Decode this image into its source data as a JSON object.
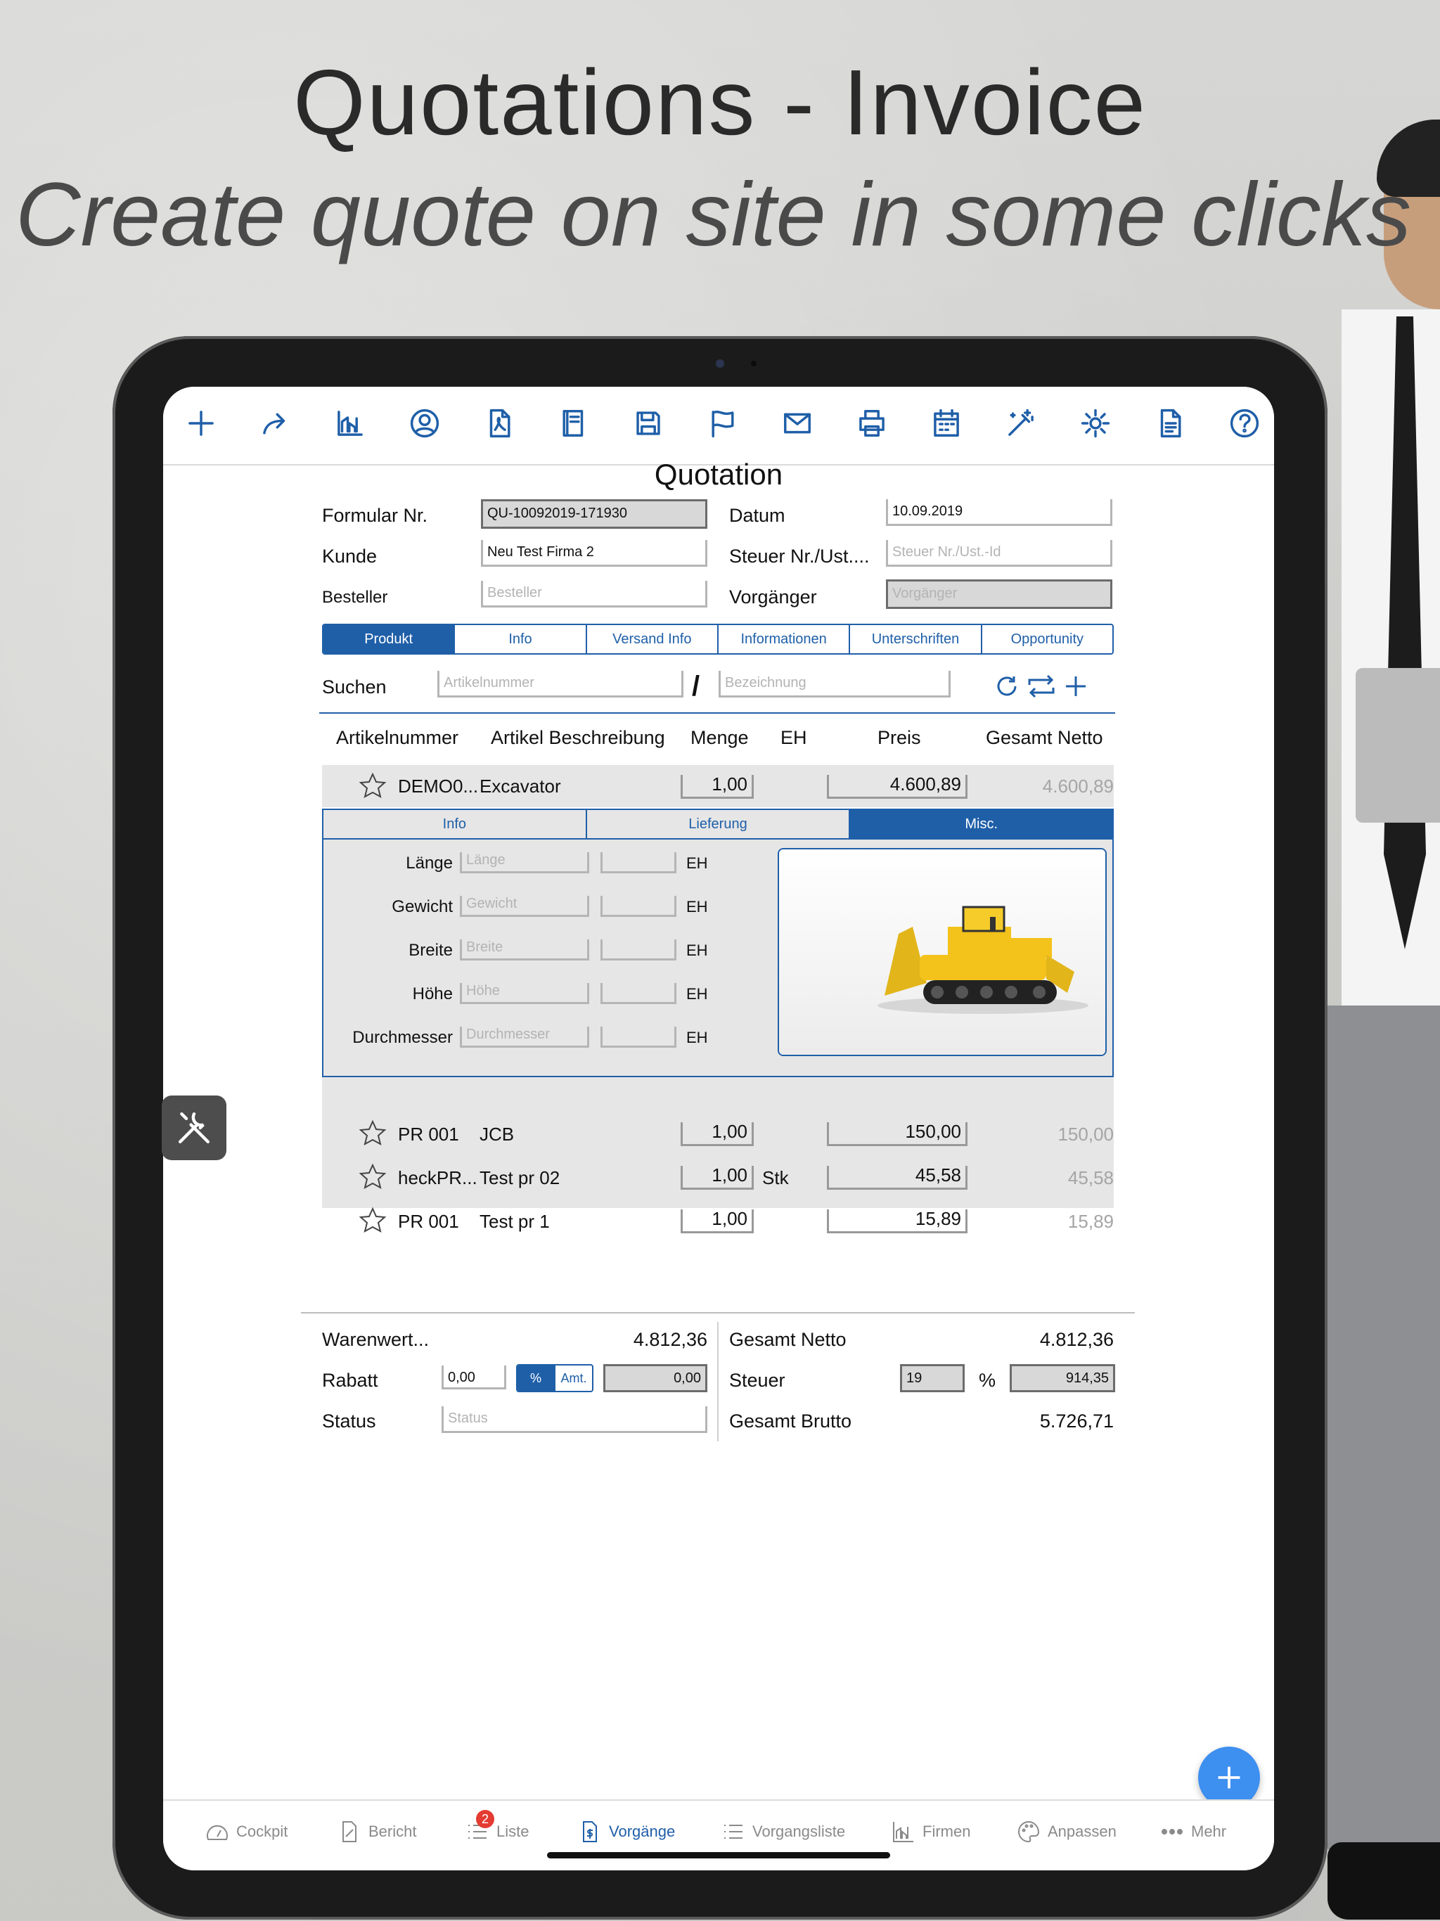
{
  "hero": {
    "title": "Quotations - Invoice",
    "subtitle": "Create quote on site in some clicks"
  },
  "toolbar_icons": [
    "plus-icon",
    "share-icon",
    "chart-icon",
    "user-icon",
    "pdf-icon",
    "book-icon",
    "save-icon",
    "flag-icon",
    "mail-icon",
    "print-icon",
    "calendar-icon",
    "magic-wand-icon",
    "gear-icon",
    "document-icon",
    "help-icon"
  ],
  "form": {
    "title": "Quotation",
    "formular_label": "Formular Nr.",
    "formular_value": "QU-10092019-171930",
    "datum_label": "Datum",
    "datum_value": "10.09.2019",
    "kunde_label": "Kunde",
    "kunde_value": "Neu Test Firma 2",
    "steuer_label": "Steuer Nr./Ust....",
    "steuer_placeholder": "Steuer Nr./Ust.-Id",
    "besteller_label": "Besteller",
    "besteller_placeholder": "Besteller",
    "vorganger_label": "Vorgänger",
    "vorganger_placeholder": "Vorgänger"
  },
  "tabs": [
    "Produkt",
    "Info",
    "Versand Info",
    "Informationen",
    "Unterschriften",
    "Opportunity"
  ],
  "active_tab": "Produkt",
  "search": {
    "label": "Suchen",
    "artikel_placeholder": "Artikelnummer",
    "separator": "/",
    "bezeichnung_placeholder": "Bezeichnung"
  },
  "columns": [
    "Artikelnummer",
    "Artikel Beschreibung",
    "Menge",
    "EH",
    "Preis",
    "Gesamt Netto"
  ],
  "items": [
    {
      "nr": "DEMO0...",
      "desc": "Excavator",
      "menge": "1,00",
      "eh": "",
      "preis": "4.600,89",
      "netto": "4.600,89"
    },
    {
      "nr": "PR 001",
      "desc": "JCB",
      "menge": "1,00",
      "eh": "",
      "preis": "150,00",
      "netto": "150,00"
    },
    {
      "nr": "heckPR...",
      "desc": "Test pr 02",
      "menge": "1,00",
      "eh": "Stk",
      "preis": "45,58",
      "netto": "45,58"
    },
    {
      "nr": "PR 001",
      "desc": "Test pr 1",
      "menge": "1,00",
      "eh": "",
      "preis": "15,89",
      "netto": "15,89"
    }
  ],
  "detail_tabs": [
    "Info",
    "Lieferung",
    "Misc."
  ],
  "detail_active": "Misc.",
  "detail_fields": [
    {
      "label": "Länge",
      "placeholder": "Länge",
      "unit": "EH"
    },
    {
      "label": "Gewicht",
      "placeholder": "Gewicht",
      "unit": "EH"
    },
    {
      "label": "Breite",
      "placeholder": "Breite",
      "unit": "EH"
    },
    {
      "label": "Höhe",
      "placeholder": "Höhe",
      "unit": "EH"
    },
    {
      "label": "Durchmesser",
      "placeholder": "Durchmesser",
      "unit": "EH"
    }
  ],
  "totals": {
    "warenwert_label": "Warenwert...",
    "warenwert": "4.812,36",
    "rabatt_label": "Rabatt",
    "rabatt_value": "0,00",
    "pct_label": "%",
    "amt_label": "Amt.",
    "rabatt_result": "0,00",
    "status_label": "Status",
    "status_placeholder": "Status",
    "gesamt_netto_label": "Gesamt Netto",
    "gesamt_netto": "4.812,36",
    "steuer_label": "Steuer",
    "steuer_rate": "19",
    "steuer_pct": "%",
    "steuer_value": "914,35",
    "gesamt_brutto_label": "Gesamt Brutto",
    "gesamt_brutto": "5.726,71"
  },
  "tabbar": [
    {
      "label": "Cockpit",
      "icon": "gauge-icon"
    },
    {
      "label": "Bericht",
      "icon": "report-icon"
    },
    {
      "label": "Liste",
      "icon": "list-icon",
      "badge": "2"
    },
    {
      "label": "Vorgänge",
      "icon": "invoice-icon"
    },
    {
      "label": "Vorgangsliste",
      "icon": "list-icon"
    },
    {
      "label": "Firmen",
      "icon": "building-chart-icon"
    },
    {
      "label": "Anpassen",
      "icon": "palette-icon"
    },
    {
      "label": "Mehr",
      "icon": "more-icon"
    }
  ],
  "active_bottom_tab": "Vorgänge",
  "colors": {
    "accent": "#1f5fa8",
    "fab": "#3d8ff0",
    "badge": "#e43b32"
  }
}
